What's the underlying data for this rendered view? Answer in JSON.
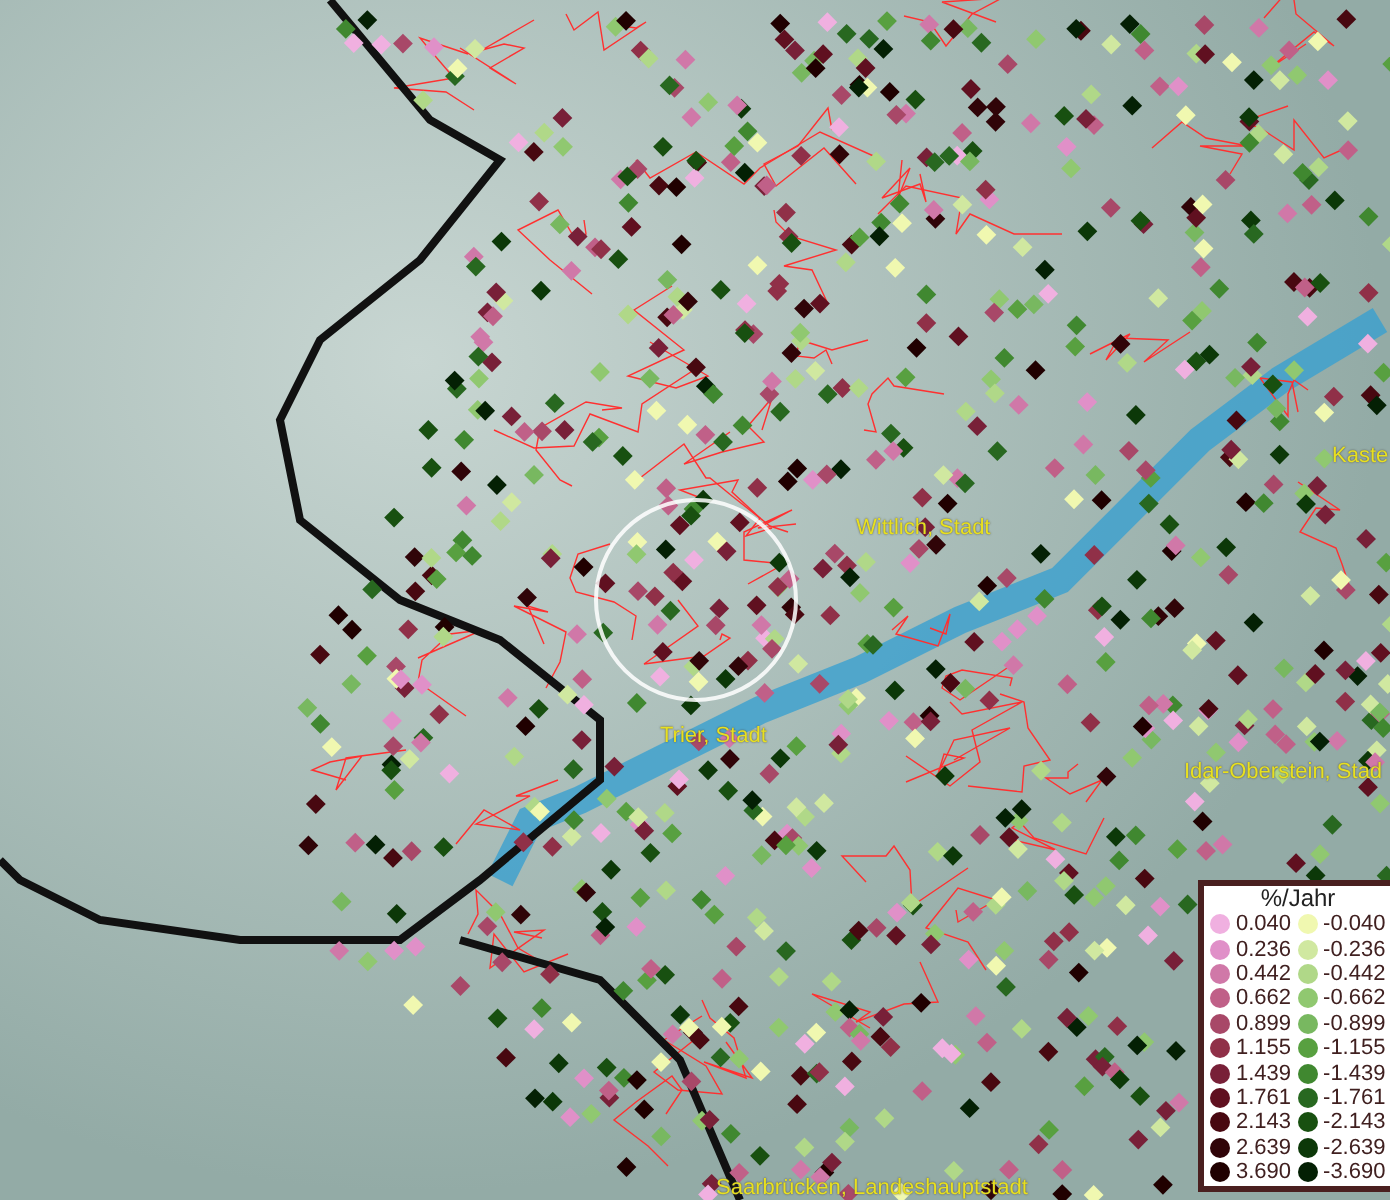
{
  "map": {
    "places": [
      {
        "name": "Wittlich, Stadt",
        "kind": "city"
      },
      {
        "name": "Trier, Stadt",
        "kind": "city"
      },
      {
        "name": "Kaste",
        "kind": "city"
      },
      {
        "name": "Idar-Oberstein, Stad",
        "kind": "city"
      },
      {
        "name": "Saarbrücken, Landeshauptstadt",
        "kind": "city"
      }
    ]
  },
  "legend": {
    "title": "%/Jahr",
    "positive": [
      {
        "value": "0.040",
        "color": "#f0b0e0"
      },
      {
        "value": "0.236",
        "color": "#e090c8"
      },
      {
        "value": "0.442",
        "color": "#d078a8"
      },
      {
        "value": "0.662",
        "color": "#c06088"
      },
      {
        "value": "0.899",
        "color": "#a84868"
      },
      {
        "value": "1.155",
        "color": "#903048"
      },
      {
        "value": "1.439",
        "color": "#782038"
      },
      {
        "value": "1.761",
        "color": "#601020"
      },
      {
        "value": "2.143",
        "color": "#480810"
      },
      {
        "value": "2.639",
        "color": "#300408"
      },
      {
        "value": "3.690",
        "color": "#200000"
      }
    ],
    "negative": [
      {
        "value": "-0.040",
        "color": "#f0f8b0"
      },
      {
        "value": "-0.236",
        "color": "#d0e8a0"
      },
      {
        "value": "-0.442",
        "color": "#b0d888"
      },
      {
        "value": "-0.662",
        "color": "#90c870"
      },
      {
        "value": "-0.899",
        "color": "#78b860"
      },
      {
        "value": "-1.155",
        "color": "#58a040"
      },
      {
        "value": "-1.439",
        "color": "#408830"
      },
      {
        "value": "-1.761",
        "color": "#286820"
      },
      {
        "value": "-2.143",
        "color": "#185010"
      },
      {
        "value": "-2.639",
        "color": "#0c3808"
      },
      {
        "value": "-3.690",
        "color": "#042004"
      }
    ]
  }
}
